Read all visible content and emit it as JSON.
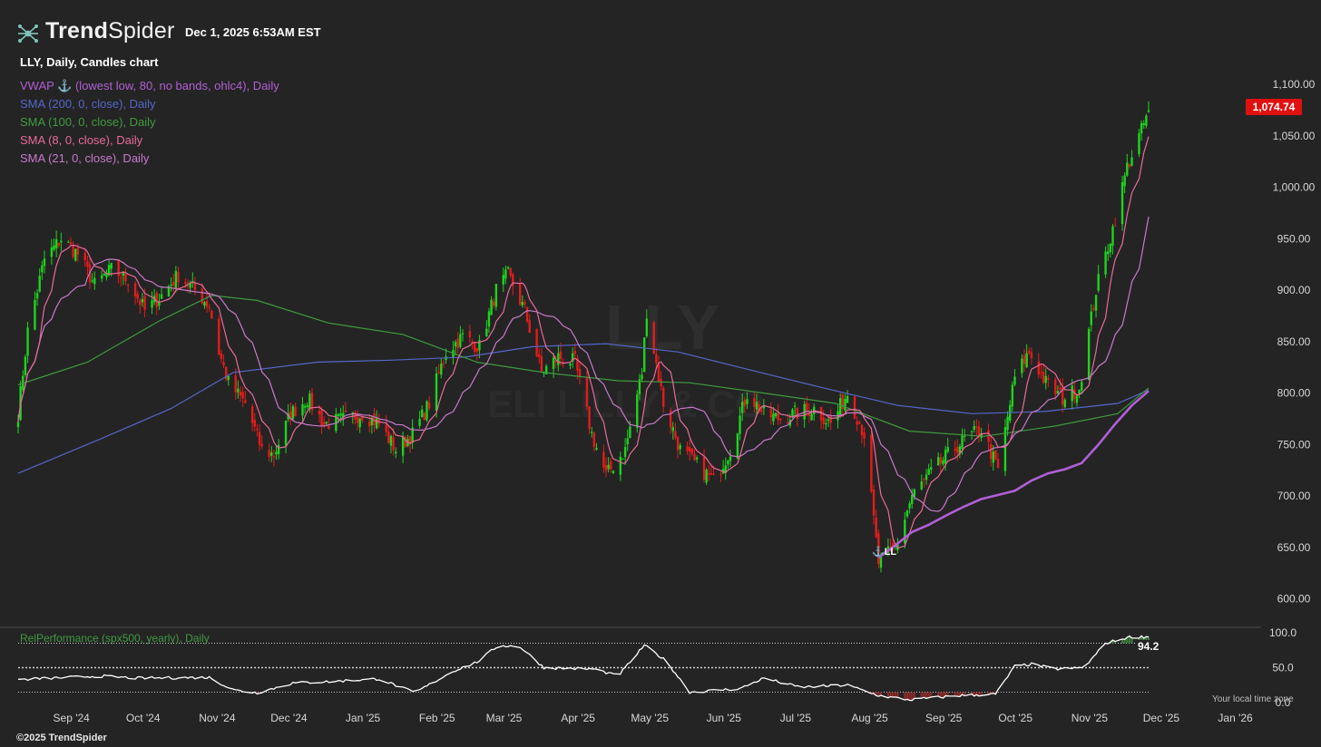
{
  "header": {
    "brand_name_bold": "Trend",
    "brand_name_light": "Spider",
    "datetime": "Dec 1, 2025 6:53AM EST",
    "chart_title": "LLY, Daily, Candles chart",
    "brand_icon": "spider-node-icon"
  },
  "legend": [
    {
      "label": "VWAP ⚓ (lowest low, 80, no bands, ohlc4), Daily",
      "color": "#b15fd6"
    },
    {
      "label": "SMA (200, 0, close), Daily",
      "color": "#5566c8"
    },
    {
      "label": "SMA (100, 0, close), Daily",
      "color": "#3f9a3f"
    },
    {
      "label": "SMA (8, 0, close), Daily",
      "color": "#e86a9a"
    },
    {
      "label": "SMA (21, 0, close), Daily",
      "color": "#c77acb"
    }
  ],
  "last_price_label": "1,074.74",
  "anchor_marker_label": "⚓LL",
  "watermark": {
    "symbol": "LLY",
    "name": "ELI LILLY & CO"
  },
  "lower_panel": {
    "label": "RelPerformance (spx500, yearly), Daily",
    "last_value_label": "94.2",
    "note": "Your local time zone"
  },
  "footer": "©2025 TrendSpider",
  "colors": {
    "up": "#1fd31f",
    "down": "#e51b1b",
    "background": "#242424",
    "price_badge": "#e01010"
  },
  "chart_data": [
    {
      "type": "candlestick",
      "title": "LLY, Daily, Candles chart",
      "x_ticks": [
        "Sep '24",
        "Oct '24",
        "Nov '24",
        "Dec '24",
        "Jan '25",
        "Feb '25",
        "Mar '25",
        "Apr '25",
        "May '25",
        "Jun '25",
        "Jul '25",
        "Aug '25",
        "Sep '25",
        "Oct '25",
        "Nov '25",
        "Dec '25",
        "Jan '26"
      ],
      "y_ticks": [
        "1,100.00",
        "1,050.00",
        "1,000.00",
        "950.00",
        "900.00",
        "850.00",
        "800.00",
        "750.00",
        "700.00",
        "650.00",
        "600.00"
      ],
      "ylim": [
        590,
        1115
      ],
      "last_price": 1074.74,
      "close_path": [
        {
          "x": "2024-08-12",
          "y": 780
        },
        {
          "x": "2024-08-16",
          "y": 860
        },
        {
          "x": "2024-08-23",
          "y": 930
        },
        {
          "x": "2024-08-30",
          "y": 950
        },
        {
          "x": "2024-09-06",
          "y": 935
        },
        {
          "x": "2024-09-13",
          "y": 905
        },
        {
          "x": "2024-09-20",
          "y": 920
        },
        {
          "x": "2024-09-27",
          "y": 910
        },
        {
          "x": "2024-10-04",
          "y": 880
        },
        {
          "x": "2024-10-11",
          "y": 895
        },
        {
          "x": "2024-10-18",
          "y": 915
        },
        {
          "x": "2024-10-25",
          "y": 900
        },
        {
          "x": "2024-10-31",
          "y": 885
        },
        {
          "x": "2024-11-04",
          "y": 840
        },
        {
          "x": "2024-11-08",
          "y": 810
        },
        {
          "x": "2024-11-15",
          "y": 790
        },
        {
          "x": "2024-11-22",
          "y": 745
        },
        {
          "x": "2024-11-27",
          "y": 740
        },
        {
          "x": "2024-12-04",
          "y": 780
        },
        {
          "x": "2024-12-11",
          "y": 795
        },
        {
          "x": "2024-12-18",
          "y": 770
        },
        {
          "x": "2024-12-27",
          "y": 775
        },
        {
          "x": "2025-01-03",
          "y": 780
        },
        {
          "x": "2025-01-10",
          "y": 770
        },
        {
          "x": "2025-01-17",
          "y": 745
        },
        {
          "x": "2025-01-24",
          "y": 760
        },
        {
          "x": "2025-01-31",
          "y": 790
        },
        {
          "x": "2025-02-07",
          "y": 840
        },
        {
          "x": "2025-02-14",
          "y": 855
        },
        {
          "x": "2025-02-21",
          "y": 845
        },
        {
          "x": "2025-02-28",
          "y": 900
        },
        {
          "x": "2025-03-05",
          "y": 915
        },
        {
          "x": "2025-03-12",
          "y": 880
        },
        {
          "x": "2025-03-19",
          "y": 820
        },
        {
          "x": "2025-03-26",
          "y": 835
        },
        {
          "x": "2025-04-02",
          "y": 830
        },
        {
          "x": "2025-04-09",
          "y": 760
        },
        {
          "x": "2025-04-15",
          "y": 720
        },
        {
          "x": "2025-04-23",
          "y": 745
        },
        {
          "x": "2025-04-30",
          "y": 820
        },
        {
          "x": "2025-05-02",
          "y": 880
        },
        {
          "x": "2025-05-09",
          "y": 790
        },
        {
          "x": "2025-05-16",
          "y": 745
        },
        {
          "x": "2025-05-23",
          "y": 730
        },
        {
          "x": "2025-05-30",
          "y": 715
        },
        {
          "x": "2025-06-06",
          "y": 745
        },
        {
          "x": "2025-06-13",
          "y": 800
        },
        {
          "x": "2025-06-20",
          "y": 780
        },
        {
          "x": "2025-06-27",
          "y": 775
        },
        {
          "x": "2025-07-03",
          "y": 780
        },
        {
          "x": "2025-07-11",
          "y": 785
        },
        {
          "x": "2025-07-18",
          "y": 770
        },
        {
          "x": "2025-07-25",
          "y": 800
        },
        {
          "x": "2025-08-01",
          "y": 760
        },
        {
          "x": "2025-08-07",
          "y": 635
        },
        {
          "x": "2025-08-14",
          "y": 650
        },
        {
          "x": "2025-08-21",
          "y": 700
        },
        {
          "x": "2025-08-28",
          "y": 720
        },
        {
          "x": "2025-09-05",
          "y": 740
        },
        {
          "x": "2025-09-12",
          "y": 755
        },
        {
          "x": "2025-09-19",
          "y": 765
        },
        {
          "x": "2025-09-26",
          "y": 725
        },
        {
          "x": "2025-10-03",
          "y": 815
        },
        {
          "x": "2025-10-09",
          "y": 840
        },
        {
          "x": "2025-10-16",
          "y": 810
        },
        {
          "x": "2025-10-23",
          "y": 795
        },
        {
          "x": "2025-10-30",
          "y": 805
        },
        {
          "x": "2025-11-06",
          "y": 900
        },
        {
          "x": "2025-11-13",
          "y": 960
        },
        {
          "x": "2025-11-19",
          "y": 1020
        },
        {
          "x": "2025-11-25",
          "y": 1055
        },
        {
          "x": "2025-11-28",
          "y": 1074.74
        }
      ],
      "series": [
        {
          "name": "VWAP ⚓ (lowest low, 80, no bands, ohlc4), Daily",
          "color": "#b15fd6",
          "points": [
            {
              "x": "2025-08-07",
              "y": 640
            },
            {
              "x": "2025-08-14",
              "y": 652
            },
            {
              "x": "2025-08-21",
              "y": 665
            },
            {
              "x": "2025-08-28",
              "y": 672
            },
            {
              "x": "2025-09-05",
              "y": 682
            },
            {
              "x": "2025-09-12",
              "y": 690
            },
            {
              "x": "2025-09-19",
              "y": 697
            },
            {
              "x": "2025-09-26",
              "y": 701
            },
            {
              "x": "2025-10-03",
              "y": 705
            },
            {
              "x": "2025-10-10",
              "y": 715
            },
            {
              "x": "2025-10-17",
              "y": 722
            },
            {
              "x": "2025-10-24",
              "y": 726
            },
            {
              "x": "2025-10-31",
              "y": 732
            },
            {
              "x": "2025-11-07",
              "y": 750
            },
            {
              "x": "2025-11-14",
              "y": 770
            },
            {
              "x": "2025-11-21",
              "y": 788
            },
            {
              "x": "2025-11-28",
              "y": 802
            }
          ]
        },
        {
          "name": "SMA (200, 0, close), Daily",
          "color": "#5566c8",
          "points": [
            {
              "x": "2024-08-12",
              "y": 722
            },
            {
              "x": "2024-09-15",
              "y": 755
            },
            {
              "x": "2024-10-15",
              "y": 785
            },
            {
              "x": "2024-11-10",
              "y": 820
            },
            {
              "x": "2024-12-15",
              "y": 830
            },
            {
              "x": "2025-01-15",
              "y": 832
            },
            {
              "x": "2025-02-15",
              "y": 835
            },
            {
              "x": "2025-03-15",
              "y": 845
            },
            {
              "x": "2025-04-15",
              "y": 848
            },
            {
              "x": "2025-05-15",
              "y": 840
            },
            {
              "x": "2025-06-15",
              "y": 822
            },
            {
              "x": "2025-07-15",
              "y": 805
            },
            {
              "x": "2025-08-15",
              "y": 788
            },
            {
              "x": "2025-09-15",
              "y": 780
            },
            {
              "x": "2025-10-15",
              "y": 782
            },
            {
              "x": "2025-11-15",
              "y": 790
            },
            {
              "x": "2025-11-28",
              "y": 803
            }
          ]
        },
        {
          "name": "SMA (100, 0, close), Daily",
          "color": "#3f9a3f",
          "points": [
            {
              "x": "2024-08-12",
              "y": 808
            },
            {
              "x": "2024-09-10",
              "y": 830
            },
            {
              "x": "2024-10-10",
              "y": 870
            },
            {
              "x": "2024-11-01",
              "y": 895
            },
            {
              "x": "2024-11-20",
              "y": 890
            },
            {
              "x": "2024-12-20",
              "y": 868
            },
            {
              "x": "2025-01-20",
              "y": 857
            },
            {
              "x": "2025-02-20",
              "y": 830
            },
            {
              "x": "2025-03-20",
              "y": 820
            },
            {
              "x": "2025-04-20",
              "y": 812
            },
            {
              "x": "2025-05-20",
              "y": 810
            },
            {
              "x": "2025-06-20",
              "y": 800
            },
            {
              "x": "2025-07-20",
              "y": 790
            },
            {
              "x": "2025-08-20",
              "y": 763
            },
            {
              "x": "2025-09-20",
              "y": 758
            },
            {
              "x": "2025-10-20",
              "y": 768
            },
            {
              "x": "2025-11-15",
              "y": 780
            },
            {
              "x": "2025-11-28",
              "y": 805
            }
          ]
        },
        {
          "name": "SMA (8, 0, close), Daily",
          "color": "#e86a9a"
        },
        {
          "name": "SMA (21, 0, close), Daily",
          "color": "#c77acb"
        }
      ]
    },
    {
      "type": "line",
      "title": "RelPerformance (spx500, yearly), Daily",
      "y_ticks": [
        "100.0",
        "50.0",
        "0.0"
      ],
      "ylim": [
        0,
        100
      ],
      "reference_lines": [
        85,
        50,
        15
      ],
      "last_value": 94.2,
      "series": [
        {
          "name": "RelPerformance (spx500, yearly), Daily",
          "color": "#ffffff",
          "points": [
            {
              "x": "2024-08-12",
              "y": 33
            },
            {
              "x": "2024-09-15",
              "y": 38
            },
            {
              "x": "2024-10-01",
              "y": 35
            },
            {
              "x": "2024-10-31",
              "y": 36
            },
            {
              "x": "2024-11-10",
              "y": 18
            },
            {
              "x": "2024-11-20",
              "y": 14
            },
            {
              "x": "2024-12-05",
              "y": 28
            },
            {
              "x": "2024-12-20",
              "y": 30
            },
            {
              "x": "2025-01-10",
              "y": 34
            },
            {
              "x": "2025-01-25",
              "y": 14
            },
            {
              "x": "2025-02-10",
              "y": 45
            },
            {
              "x": "2025-02-20",
              "y": 58
            },
            {
              "x": "2025-03-01",
              "y": 82
            },
            {
              "x": "2025-03-10",
              "y": 80
            },
            {
              "x": "2025-03-20",
              "y": 50
            },
            {
              "x": "2025-04-10",
              "y": 48
            },
            {
              "x": "2025-04-20",
              "y": 38
            },
            {
              "x": "2025-05-01",
              "y": 82
            },
            {
              "x": "2025-05-10",
              "y": 60
            },
            {
              "x": "2025-05-20",
              "y": 15
            },
            {
              "x": "2025-06-10",
              "y": 20
            },
            {
              "x": "2025-06-20",
              "y": 35
            },
            {
              "x": "2025-07-05",
              "y": 22
            },
            {
              "x": "2025-07-25",
              "y": 25
            },
            {
              "x": "2025-08-07",
              "y": 10
            },
            {
              "x": "2025-08-20",
              "y": 4
            },
            {
              "x": "2025-09-10",
              "y": 10
            },
            {
              "x": "2025-09-25",
              "y": 12
            },
            {
              "x": "2025-10-03",
              "y": 52
            },
            {
              "x": "2025-10-10",
              "y": 55
            },
            {
              "x": "2025-10-20",
              "y": 48
            },
            {
              "x": "2025-11-01",
              "y": 50
            },
            {
              "x": "2025-11-10",
              "y": 85
            },
            {
              "x": "2025-11-20",
              "y": 94
            },
            {
              "x": "2025-11-28",
              "y": 94.2
            }
          ]
        }
      ]
    }
  ]
}
